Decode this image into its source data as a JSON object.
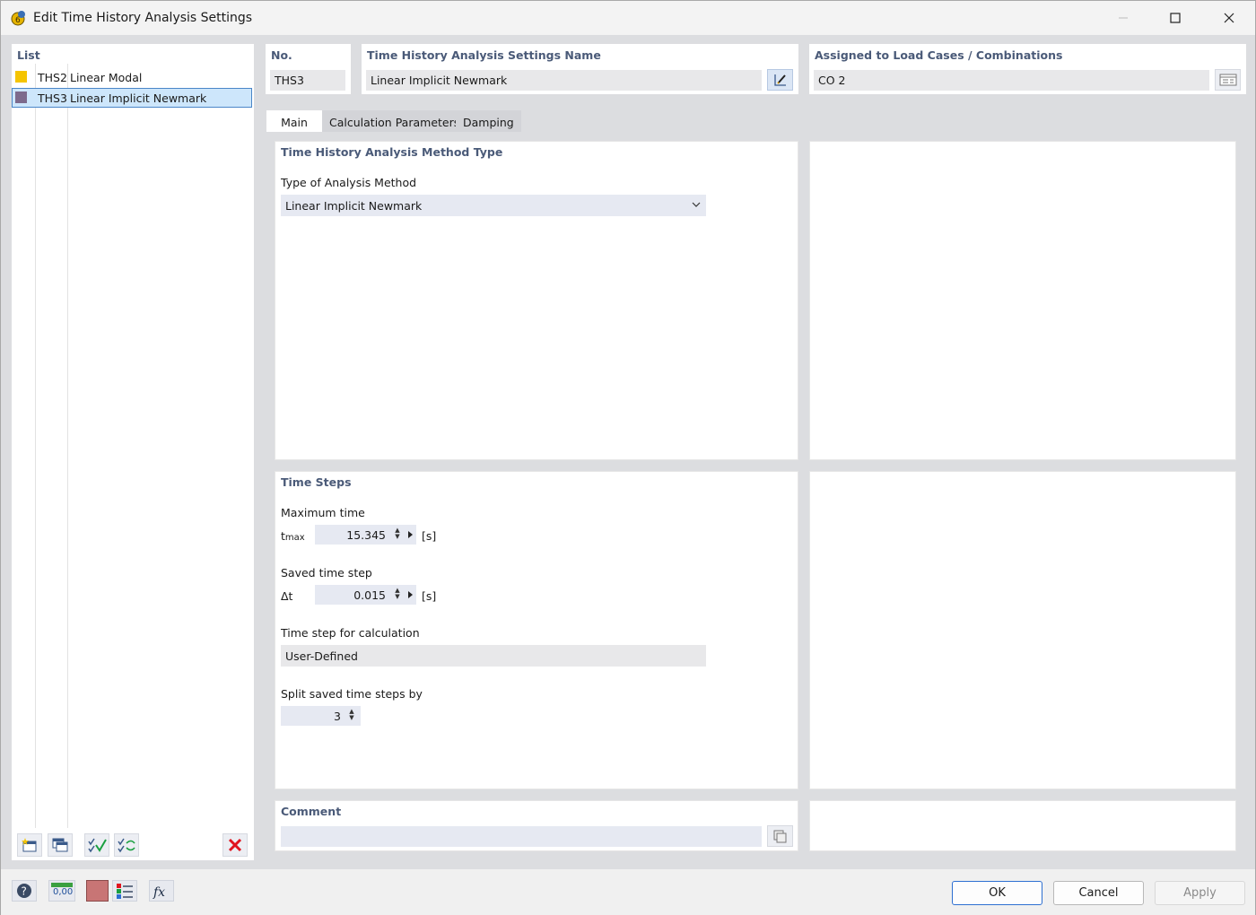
{
  "window": {
    "title": "Edit Time History Analysis Settings",
    "icons": {
      "app": "app-icon",
      "minimize": "minimize-icon",
      "maximize": "maximize-icon",
      "close": "close-icon"
    }
  },
  "list": {
    "header": "List",
    "items": [
      {
        "code": "THS2",
        "name": "Linear Modal",
        "color": "#f5c400",
        "selected": false
      },
      {
        "code": "THS3",
        "name": "Linear Implicit Newmark",
        "color": "#7d6a8c",
        "selected": true
      }
    ],
    "toolbar_icons": [
      "new-item-icon",
      "copy-item-icon",
      "check-all-icon",
      "renumber-icon",
      "delete-icon"
    ]
  },
  "header": {
    "no_label": "No.",
    "no_value": "THS3",
    "name_label": "Time History Analysis Settings Name",
    "name_value": "Linear Implicit Newmark",
    "assigned_label": "Assigned to Load Cases / Combinations",
    "assigned_value": "CO 2"
  },
  "tabs": [
    {
      "label": "Main",
      "active": true
    },
    {
      "label": "Calculation Parameters",
      "active": false
    },
    {
      "label": "Damping",
      "active": false
    }
  ],
  "method": {
    "section_title": "Time History Analysis Method Type",
    "type_label": "Type of Analysis Method",
    "type_value": "Linear Implicit Newmark"
  },
  "time_steps": {
    "section_title": "Time Steps",
    "max_time_label": "Maximum time",
    "max_time_symbol": "t",
    "max_time_sub": "max",
    "max_time_value": "15.345",
    "max_time_unit": "[s]",
    "saved_step_label": "Saved time step",
    "saved_step_symbol": "Δt",
    "saved_step_value": "0.015",
    "saved_step_unit": "[s]",
    "calc_step_label": "Time step for calculation",
    "calc_step_value": "User-Defined",
    "split_label": "Split saved time steps by",
    "split_value": "3"
  },
  "comment": {
    "section_title": "Comment",
    "value": ""
  },
  "buttons": {
    "ok": "OK",
    "cancel": "Cancel",
    "apply": "Apply"
  },
  "bottom_tools": {
    "units_label": "0,00"
  },
  "colors": {
    "accent": "#2d6fd1",
    "section_title": "#4a5a78",
    "selection": "#cde6fb",
    "delete": "#e0141e"
  }
}
